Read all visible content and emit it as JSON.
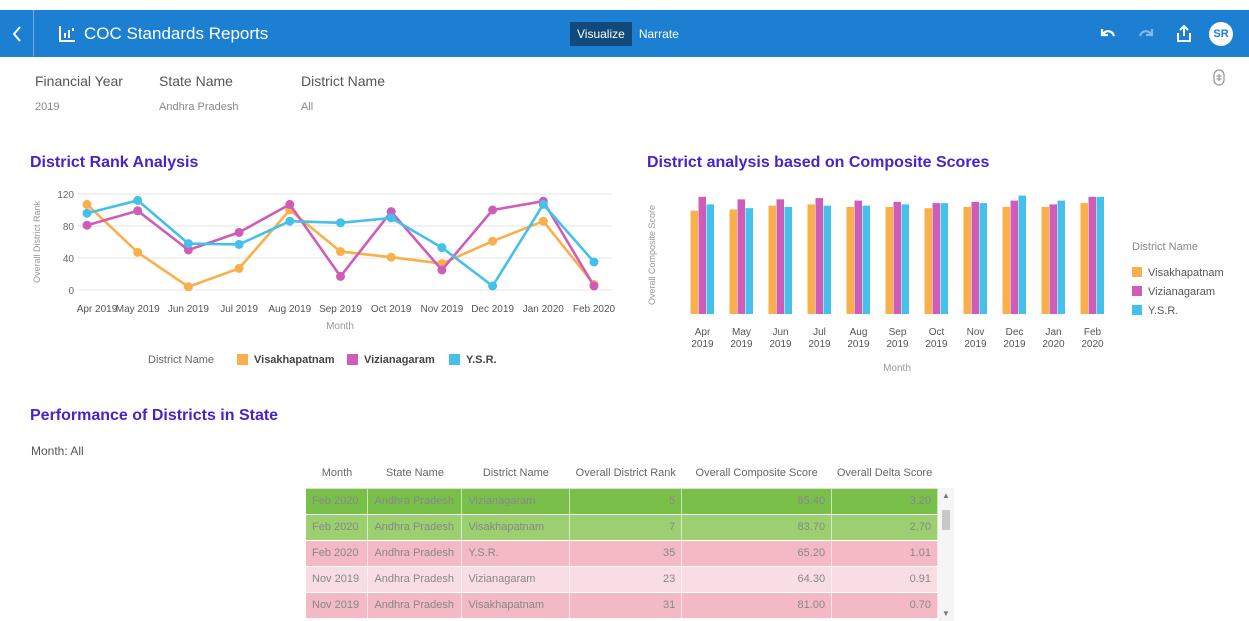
{
  "header": {
    "title": "COC Standards Reports",
    "tabs": [
      {
        "label": "Visualize"
      },
      {
        "label": "Narrate"
      }
    ],
    "avatar": "SR"
  },
  "filters": {
    "financial_year": {
      "label": "Financial Year",
      "value": "2019"
    },
    "state_name": {
      "label": "State Name",
      "value": "Andhra Pradesh"
    },
    "district_name": {
      "label": "District Name",
      "value": "All"
    }
  },
  "sections": {
    "rank_title": "District Rank Analysis",
    "composite_title": "District analysis based on Composite Scores",
    "perf_title": "Performance of Districts in State",
    "month_filter": "Month: All"
  },
  "colors": {
    "visakhapatnam": "#f9b04a",
    "vizianagaram": "#cf5db8",
    "ysr": "#45c0ea",
    "row_green_dark": "#79c04a",
    "row_green": "#9bcf6f",
    "row_pink": "#f3b9c4",
    "row_pink_light": "#f8dde2"
  },
  "chart_data": [
    {
      "type": "line",
      "title": "District Rank Analysis",
      "xlabel": "Month",
      "ylabel": "Overall District Rank",
      "ylim": [
        0,
        120
      ],
      "yticks": [
        "0",
        "40",
        "80",
        "120"
      ],
      "categories": [
        "Apr 2019",
        "May 2019",
        "Jun 2019",
        "Jul 2019",
        "Aug 2019",
        "Sep 2019",
        "Oct 2019",
        "Nov 2019",
        "Dec 2019",
        "Jan 2020",
        "Feb 2020"
      ],
      "legend_title": "District Name",
      "legend_position": "bottom",
      "series": [
        {
          "name": "Visakhapatnam",
          "values": [
            107,
            47,
            4,
            27,
            100,
            48,
            41,
            33,
            61,
            86,
            7
          ]
        },
        {
          "name": "Vizianagaram",
          "values": [
            81,
            99,
            50,
            72,
            107,
            17,
            98,
            25,
            100,
            111,
            5
          ]
        },
        {
          "name": "Y.S.R.",
          "values": [
            96,
            112,
            58,
            57,
            86,
            84,
            90,
            53,
            5,
            107,
            35
          ]
        }
      ]
    },
    {
      "type": "bar",
      "title": "District analysis based on Composite Scores",
      "xlabel": "Month",
      "ylabel": "Overall Composite Score",
      "ylim": [
        0,
        100
      ],
      "categories": [
        [
          "Apr",
          "2019"
        ],
        [
          "May",
          "2019"
        ],
        [
          "Jun",
          "2019"
        ],
        [
          "Jul",
          "2019"
        ],
        [
          "Aug",
          "2019"
        ],
        [
          "Sep",
          "2019"
        ],
        [
          "Oct",
          "2019"
        ],
        [
          "Nov",
          "2019"
        ],
        [
          "Dec",
          "2019"
        ],
        [
          "Jan",
          "2020"
        ],
        [
          "Feb",
          "2020"
        ]
      ],
      "legend_title": "District Name",
      "legend_position": "right",
      "series": [
        {
          "name": "Visakhapatnam",
          "values": [
            82,
            83,
            86,
            87,
            85,
            85,
            84,
            85,
            85,
            85,
            88
          ]
        },
        {
          "name": "Vizianagaram",
          "values": [
            93,
            91,
            91,
            92,
            90,
            89,
            88,
            89,
            90,
            87,
            93
          ]
        },
        {
          "name": "Y.S.R.",
          "values": [
            87,
            84,
            85,
            86,
            86,
            87,
            88,
            88,
            94,
            90,
            93
          ]
        }
      ]
    }
  ],
  "table": {
    "columns": [
      "Month",
      "State Name",
      "District Name",
      "Overall District Rank",
      "Overall Composite Score",
      "Overall Delta Score"
    ],
    "rows": [
      {
        "cells": [
          "Feb 2020",
          "Andhra Pradesh",
          "Vizianagaram",
          "5",
          "85.40",
          "3.20"
        ],
        "color": "row_green_dark"
      },
      {
        "cells": [
          "Feb 2020",
          "Andhra Pradesh",
          "Visakhapatnam",
          "7",
          "83.70",
          "2.70"
        ],
        "color": "row_green"
      },
      {
        "cells": [
          "Feb 2020",
          "Andhra Pradesh",
          "Y.S.R.",
          "35",
          "65.20",
          "1.01"
        ],
        "color": "row_pink"
      },
      {
        "cells": [
          "Nov 2019",
          "Andhra Pradesh",
          "Vizianagaram",
          "23",
          "64.30",
          "0.91"
        ],
        "color": "row_pink_light"
      },
      {
        "cells": [
          "Nov 2019",
          "Andhra Pradesh",
          "Visakhapatnam",
          "31",
          "81.00",
          "0.70"
        ],
        "color": "row_pink"
      }
    ]
  }
}
